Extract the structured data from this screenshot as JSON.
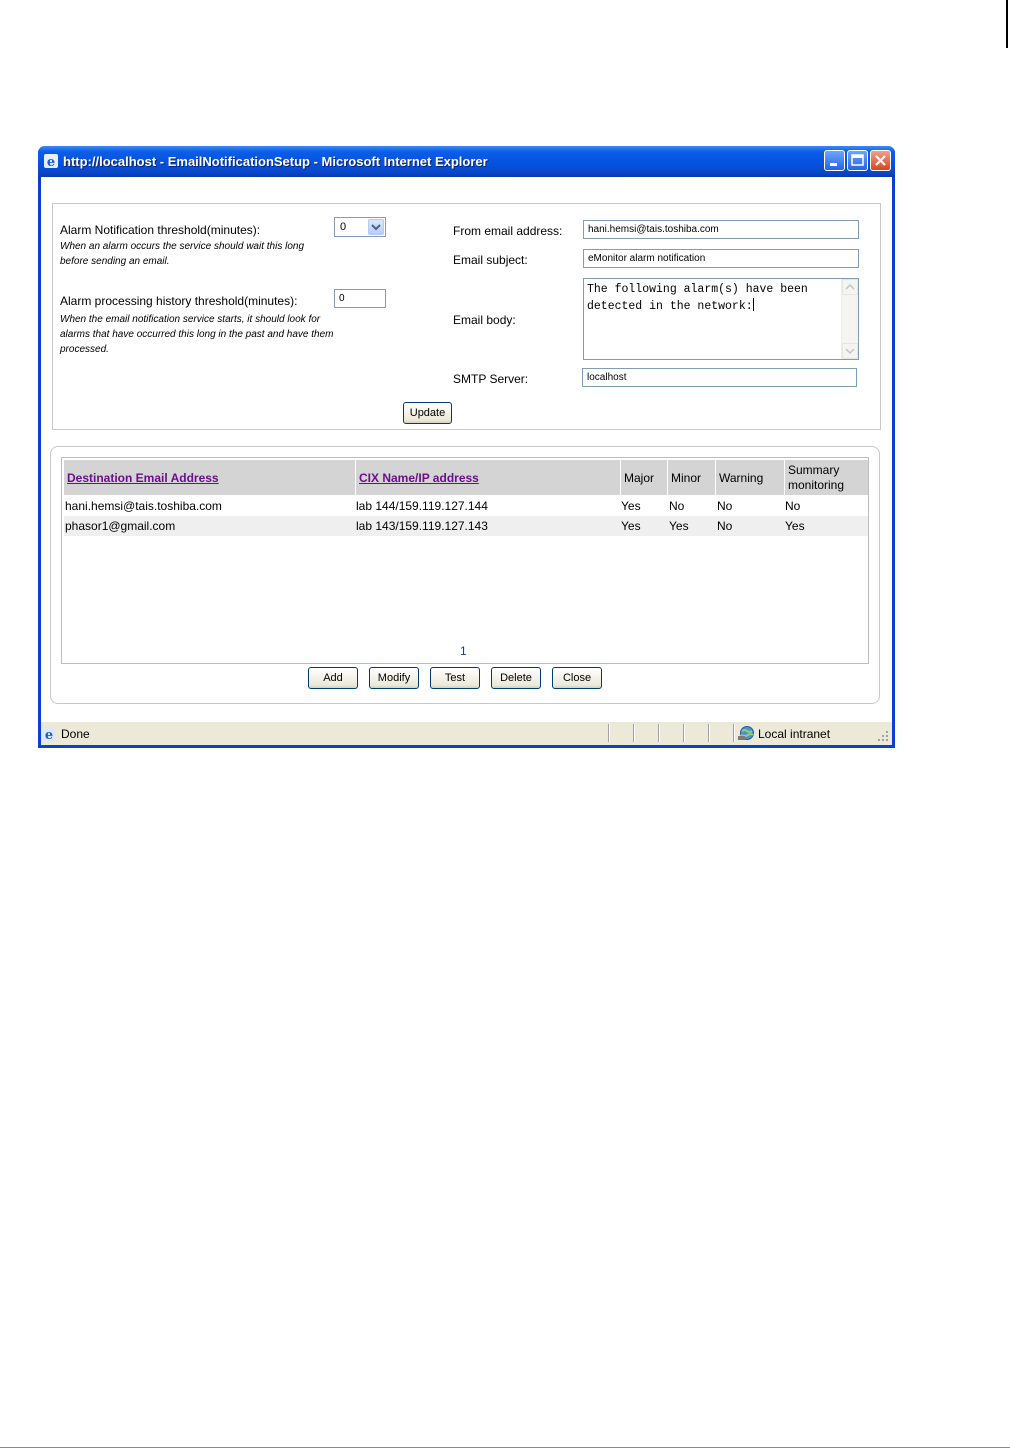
{
  "window": {
    "title": "http://localhost - EmailNotificationSetup - Microsoft Internet Explorer",
    "controls": [
      "minimize-icon",
      "maximize-icon",
      "close-icon"
    ]
  },
  "settings": {
    "alarm_threshold": {
      "label": "Alarm Notification threshold(minutes):",
      "value": "0",
      "help": "When an alarm occurs the service should wait this long before sending an email."
    },
    "history_threshold": {
      "label": "Alarm processing history threshold(minutes):",
      "value": "0",
      "help": "When the email notification service starts, it should look for alarms that have occurred this long in the past and have them processed."
    },
    "from_email": {
      "label": "From email address:",
      "value": "hani.hemsi@tais.toshiba.com"
    },
    "subject": {
      "label": "Email subject:",
      "value": "eMonitor alarm notification"
    },
    "body": {
      "label": "Email body:",
      "value": "The following alarm(s) have been detected in the network:"
    },
    "smtp": {
      "label": "SMTP Server:",
      "value": "localhost"
    },
    "update_label": "Update"
  },
  "table": {
    "headers": {
      "email": "Destination Email Address",
      "cix": "CIX Name/IP address",
      "major": "Major",
      "minor": "Minor",
      "warning": "Warning",
      "summary": "Summary monitoring"
    },
    "rows": [
      {
        "email": "hani.hemsi@tais.toshiba.com",
        "cix": "lab 144/159.119.127.144",
        "major": "Yes",
        "minor": "No",
        "warning": "No",
        "summary": "No"
      },
      {
        "email": "phasor1@gmail.com",
        "cix": "lab 143/159.119.127.143",
        "major": "Yes",
        "minor": "Yes",
        "warning": "No",
        "summary": "Yes"
      }
    ],
    "page": "1"
  },
  "actions": {
    "add": "Add",
    "modify": "Modify",
    "test": "Test",
    "delete": "Delete",
    "close": "Close"
  },
  "statusbar": {
    "status": "Done",
    "zone": "Local intranet"
  },
  "colors": {
    "titlebar": "#0553e0",
    "link": "#6b0f8a",
    "header_bg": "#d4d4d4",
    "statusbar_bg": "#ece9d8"
  }
}
